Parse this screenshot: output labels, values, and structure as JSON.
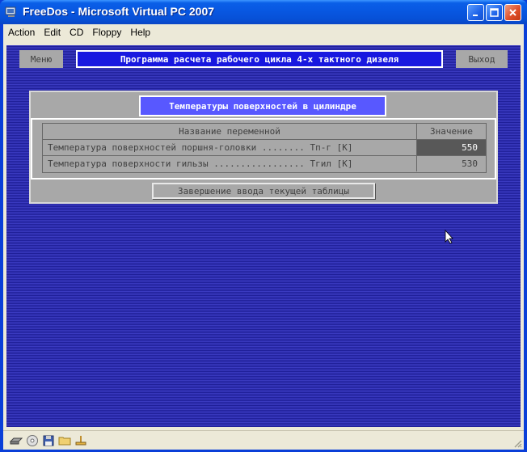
{
  "window": {
    "title": "FreeDos - Microsoft Virtual PC 2007"
  },
  "menu": [
    "Action",
    "Edit",
    "CD",
    "Floppy",
    "Help"
  ],
  "dos": {
    "menu_button": "Меню",
    "exit_button": "Выход",
    "header": "Программа расчета рабочего цикла 4-х тактного дизеля",
    "panel_title": "Температуры поверхностей в цилиндре",
    "table": {
      "col_name": "Название переменной",
      "col_value": "Значение",
      "rows": [
        {
          "name": "Температура поверхностей поршня-головки ........ Тп-г [K]",
          "value": "550"
        },
        {
          "name": "Температура поверхности гильзы ................. Тгил [K]",
          "value": "530"
        }
      ]
    },
    "finish_button": "Завершение ввода текущей таблицы"
  },
  "colors": {
    "titlebar": "#0a5fe8",
    "dos_background": "#2828a8",
    "header_bar": "#1818e0",
    "panel_title": "#5858ff",
    "panel": "#a8a8a8",
    "selected_cell": "#585858"
  }
}
